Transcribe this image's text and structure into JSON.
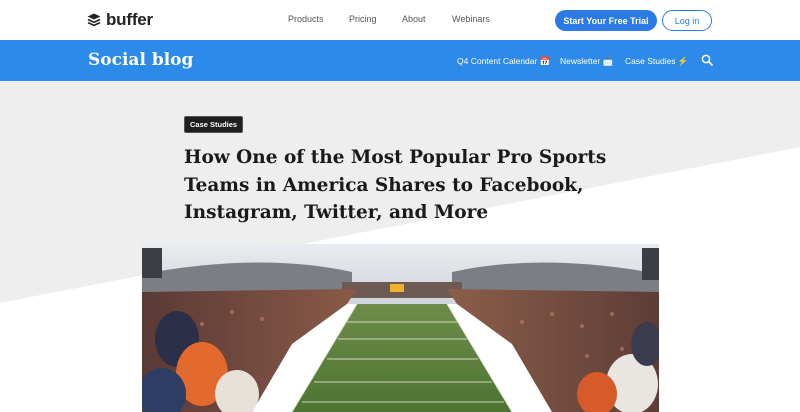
{
  "brand": {
    "name": "buffer",
    "logo_icon": "stack-layers-icon"
  },
  "topnav": {
    "links": [
      "Products",
      "Pricing",
      "About",
      "Webinars"
    ],
    "trial_button": "Start Your Free Trial",
    "login_button": "Log in"
  },
  "blogbar": {
    "title": "Social blog",
    "links": [
      {
        "label": "Q4 Content Calendar 📅",
        "icon": "calendar-icon"
      },
      {
        "label": "Newsletter 📩",
        "icon": "envelope-icon"
      },
      {
        "label": "Case Studies ⚡",
        "icon": "lightning-icon"
      }
    ],
    "search_icon": "search-icon"
  },
  "article": {
    "category": "Case Studies",
    "headline_lines": [
      "How One of the Most Popular Pro Sports",
      "Teams in America Shares to Facebook,",
      "Instagram, Twitter, and More"
    ],
    "image": "stadium-panorama-photo"
  },
  "colors": {
    "primary": "#2c7be5",
    "blogbar": "#2c8ae8",
    "badge": "#1f1f1f",
    "hero_gray": "#eeeeee"
  }
}
